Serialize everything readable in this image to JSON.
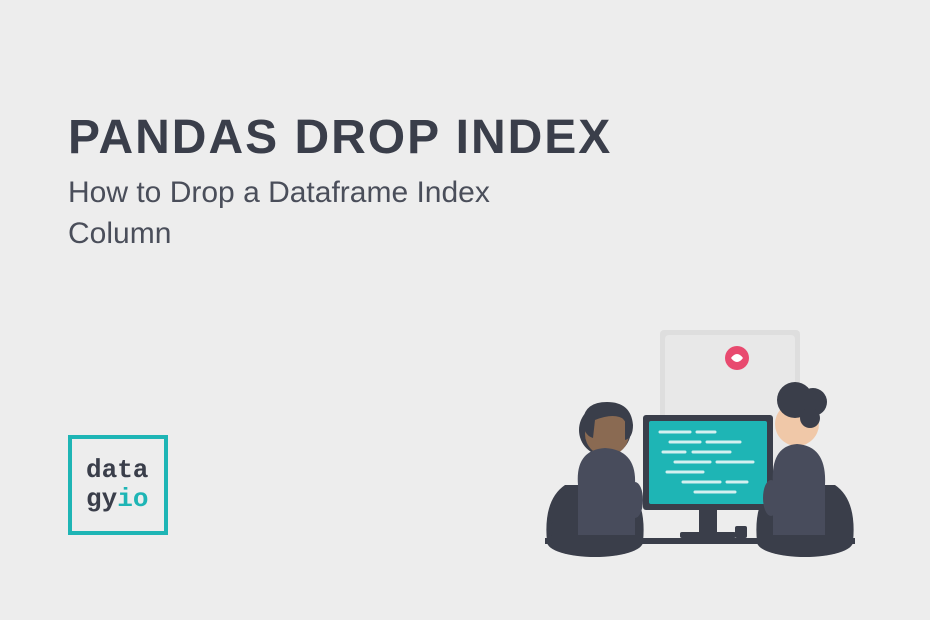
{
  "title": "PANDAS DROP INDEX",
  "subtitle": "How to Drop a Dataframe Index Column",
  "logo": {
    "line1": "data",
    "line2_part1": "gy",
    "line2_part2": "io"
  }
}
